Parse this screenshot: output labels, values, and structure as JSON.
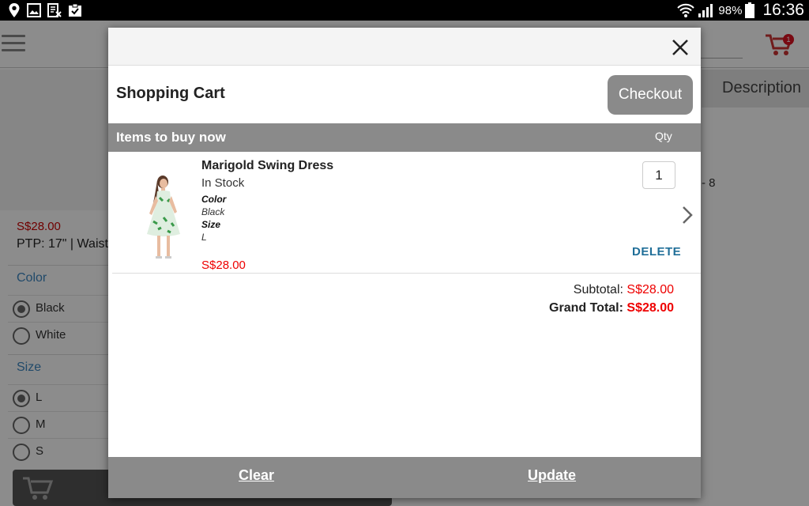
{
  "status_bar": {
    "battery_percent": "98%",
    "time": "16:36",
    "icons": [
      "location-icon",
      "image-icon",
      "document-x-icon",
      "clipboard-check-icon",
      "wifi-icon",
      "signal-icon",
      "battery-icon"
    ]
  },
  "background": {
    "cart_badge_count": "1",
    "description_tab": "Description",
    "size_range": "- 8",
    "price": "S$28.00",
    "measurements": "PTP: 17\" | Waist",
    "color_label": "Color",
    "color_options": [
      {
        "label": "Black",
        "selected": true
      },
      {
        "label": "White",
        "selected": false
      }
    ],
    "size_label": "Size",
    "size_options": [
      {
        "label": "L",
        "selected": true
      },
      {
        "label": "M",
        "selected": false
      },
      {
        "label": "S",
        "selected": false
      }
    ]
  },
  "cart": {
    "title": "Shopping Cart",
    "checkout_label": "Checkout",
    "items_header": "Items to buy now",
    "qty_header": "Qty",
    "items": [
      {
        "name": "Marigold Swing Dress",
        "stock": "In Stock",
        "color_label": "Color",
        "color_value": "Black",
        "size_label": "Size",
        "size_value": "L",
        "price": "S$28.00",
        "qty": "1",
        "delete_label": "DELETE"
      }
    ],
    "subtotal_label": "Subtotal:",
    "subtotal_value": "S$28.00",
    "grand_total_label": "Grand Total:",
    "grand_total_value": "S$28.00",
    "clear_label": "Clear",
    "update_label": "Update"
  },
  "colors": {
    "accent_red": "#e00000",
    "bar_gray": "#8a8a8a",
    "link_blue": "#1f6e98",
    "option_blue": "#3d87c2"
  }
}
